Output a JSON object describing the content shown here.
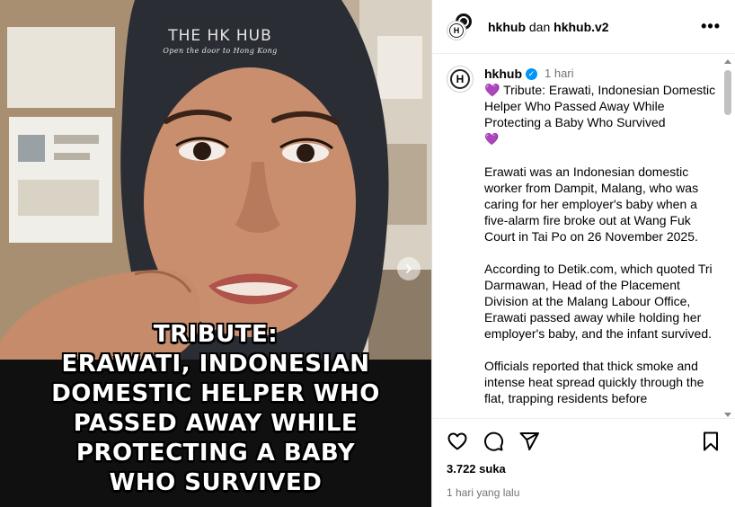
{
  "watermark": {
    "title": "THE HK HUB",
    "subtitle": "Open the door to Hong Kong"
  },
  "caption_lines": [
    "TRIBUTE:",
    "ERAWATI, INDONESIAN",
    "DOMESTIC HELPER WHO",
    "PASSED AWAY WHILE",
    "PROTECTING A BABY",
    "WHO SURVIVED"
  ],
  "header": {
    "user1": "hkhub",
    "connector": "dan",
    "user2": "hkhub.v2",
    "more": "•••"
  },
  "post": {
    "avatar_letter": "H",
    "username": "hkhub",
    "time": "1 hari",
    "title": "Tribute: Erawati, Indonesian Domestic Helper Who Passed Away While Protecting a Baby Who Survived",
    "heart_start": "💜",
    "heart_end": "💜",
    "paragraphs": [
      "Erawati was an Indonesian domestic worker from Dampit, Malang, who was caring for her employer's baby when a five-alarm fire broke out at Wang Fuk Court in Tai Po on 26 November 2025.",
      "According to Detik.com, which quoted Tri Darmawan, Head of the Placement Division at the Malang Labour Office, Erawati passed away while holding her employer's baby, and the infant survived.",
      "Officials reported that thick smoke and intense heat spread quickly through the flat, trapping residents before"
    ]
  },
  "footer": {
    "likes": "3.722 suka",
    "date": "1 hari yang lalu"
  },
  "icons": [
    "heart-icon",
    "comment-icon",
    "share-icon",
    "bookmark-icon",
    "chevron-right-icon",
    "verified-badge-icon"
  ],
  "colors": {
    "verified": "#0095f6",
    "muted": "#737373",
    "caption_band": "#101010"
  }
}
